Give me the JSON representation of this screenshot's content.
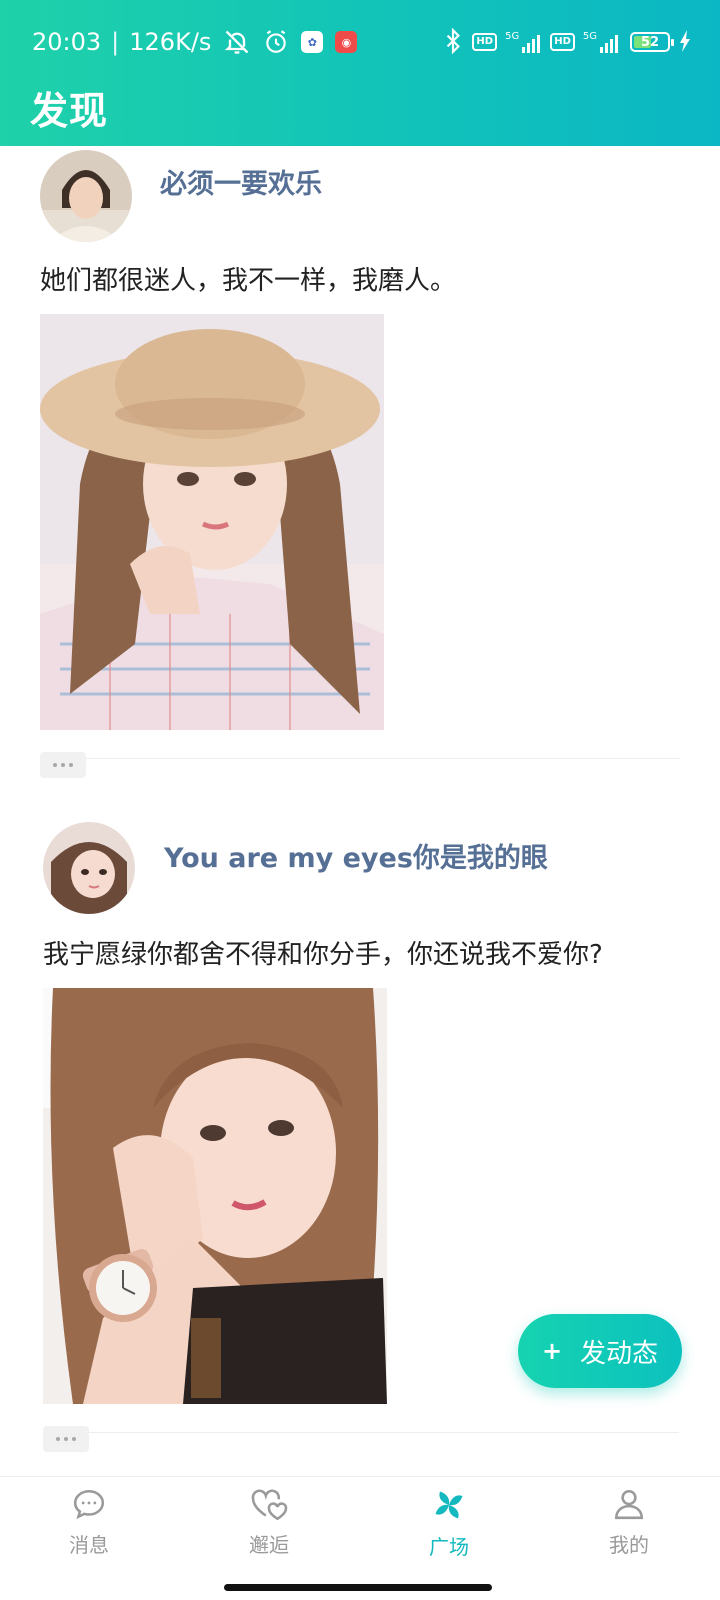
{
  "status_bar": {
    "time": "20:03",
    "separator": "|",
    "network_speed": "126K/s",
    "hd_label": "HD",
    "network_type": "5G",
    "battery": "52",
    "battery_level": 0.52,
    "icons": [
      "notifications-off-icon",
      "alarm-icon",
      "app-icon",
      "app-icon-red",
      "bluetooth-icon",
      "signal-icon",
      "battery-icon",
      "charging-icon"
    ]
  },
  "header": {
    "title": "发现"
  },
  "posts": [
    {
      "username": "必须一要欢乐",
      "text": "她们都很迷人，我不一样，我磨人。"
    },
    {
      "username": "You are my eyes你是我的眼",
      "text": "我宁愿绿你都舍不得和你分手，你还说我不爱你?"
    }
  ],
  "fab": {
    "icon": "+",
    "label": "发动态"
  },
  "bottom_nav": [
    {
      "label": "消息",
      "icon": "message-icon",
      "active": false
    },
    {
      "label": "邂逅",
      "icon": "hearts-icon",
      "active": false
    },
    {
      "label": "广场",
      "icon": "pinwheel-icon",
      "active": true
    },
    {
      "label": "我的",
      "icon": "person-icon",
      "active": false
    }
  ],
  "colors": {
    "header_gradient_start": "#1fd1a9",
    "header_gradient_end": "#0bb7c4",
    "accent": "#13b9bf",
    "username": "#566f95",
    "nav_inactive": "#9a9a9a"
  }
}
